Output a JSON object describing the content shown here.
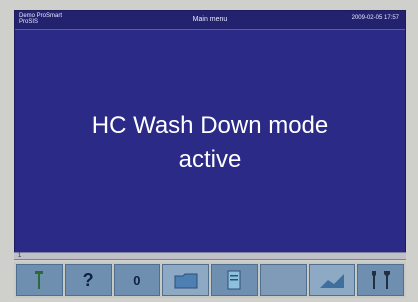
{
  "header": {
    "left_line1": "Demo ProSmart",
    "left_line2": "ProSIS",
    "title": "Main menu",
    "right_text": "2009-02-05 17:57"
  },
  "main": {
    "message_line1": "HC Wash Down mode",
    "message_line2": "active"
  },
  "status_strip": {
    "text": "1"
  },
  "toolbar": {
    "buttons": [
      {
        "label": "",
        "icon": "pin-icon"
      },
      {
        "label": "?",
        "icon": "help-icon"
      },
      {
        "label": "0",
        "icon": "zero-icon"
      },
      {
        "label": "",
        "icon": "folder-icon"
      },
      {
        "label": "",
        "icon": "document-icon"
      },
      {
        "label": "",
        "icon": "blank"
      },
      {
        "label": "",
        "icon": "graph-icon"
      },
      {
        "label": "",
        "icon": "tools-icon"
      }
    ]
  },
  "colors": {
    "panel_background": "#2b2a86",
    "message_text": "#ffffff",
    "toolbar_button": "#6f8fb0"
  }
}
